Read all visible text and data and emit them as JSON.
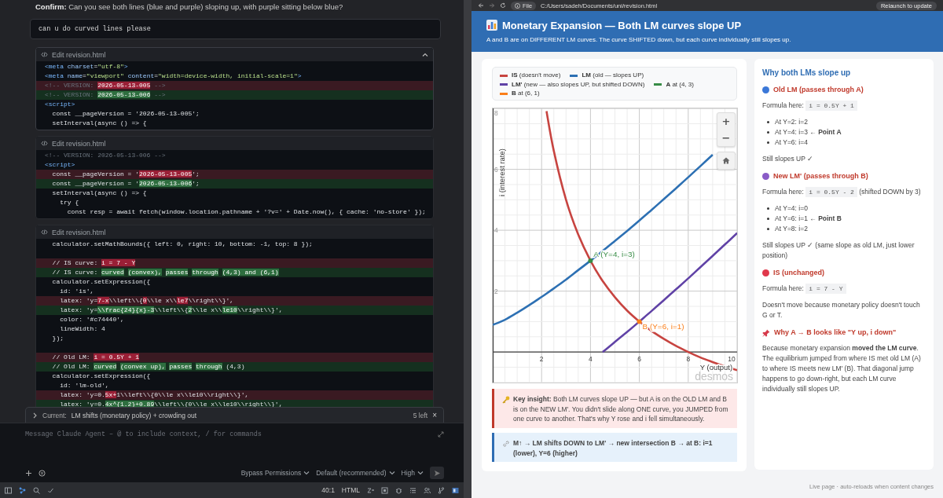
{
  "chat": {
    "confirm": "**Confirm:** Can you see both lines (blue and purple) sloping up, with purple sitting below blue?",
    "user_message": "can u do curved lines please",
    "edits": [
      {
        "title": "Edit revision.html",
        "hovered": true,
        "lines": [
          {
            "kind": "context",
            "parts": [
              {
                "text": "<meta ",
                "kind": "tag"
              },
              {
                "text": "charset",
                "kind": "attr"
              },
              {
                "text": "=",
                "kind": "plain"
              },
              {
                "text": "\"utf-8\"",
                "kind": "string"
              },
              {
                "text": ">",
                "kind": "tag"
              }
            ]
          },
          {
            "kind": "context",
            "parts": [
              {
                "text": "<meta ",
                "kind": "tag"
              },
              {
                "text": "name",
                "kind": "attr"
              },
              {
                "text": "=",
                "kind": "plain"
              },
              {
                "text": "\"viewport\"",
                "kind": "string"
              },
              {
                "text": " content",
                "kind": "attr"
              },
              {
                "text": "=",
                "kind": "plain"
              },
              {
                "text": "\"width=device-width, initial-scale=1\"",
                "kind": "string"
              },
              {
                "text": ">",
                "kind": "tag"
              }
            ]
          },
          {
            "kind": "removed",
            "parts": [
              {
                "text": "<!-- VERSION: ",
                "kind": "comment"
              },
              {
                "text": "2026-05-13-005",
                "kind": "hl"
              },
              {
                "text": " -->",
                "kind": "comment"
              }
            ]
          },
          {
            "kind": "added",
            "parts": [
              {
                "text": "<!-- VERSION: ",
                "kind": "comment"
              },
              {
                "text": "2026-05-13-006",
                "kind": "hl"
              },
              {
                "text": " -->",
                "kind": "comment"
              }
            ]
          },
          {
            "kind": "context",
            "parts": [
              {
                "text": "<script>",
                "kind": "tag"
              }
            ]
          },
          {
            "kind": "context",
            "parts": [
              {
                "text": "  const __pageVersion = '2026-05-13-005';",
                "kind": "plain"
              }
            ]
          },
          {
            "kind": "context",
            "parts": [
              {
                "text": "  setInterval(async () => {",
                "kind": "plain"
              }
            ]
          }
        ]
      },
      {
        "title": "Edit revision.html",
        "hovered": false,
        "lines": [
          {
            "kind": "context",
            "parts": [
              {
                "text": "<!-- VERSION: 2026-05-13-006 -->",
                "kind": "comment"
              }
            ]
          },
          {
            "kind": "context",
            "parts": [
              {
                "text": "<script>",
                "kind": "tag"
              }
            ]
          },
          {
            "kind": "removed",
            "parts": [
              {
                "text": "  const __pageVersion = '",
                "kind": "plain"
              },
              {
                "text": "2026-05-13-005",
                "kind": "hl"
              },
              {
                "text": "';",
                "kind": "plain"
              }
            ]
          },
          {
            "kind": "added",
            "parts": [
              {
                "text": "  const __pageVersion = '",
                "kind": "plain"
              },
              {
                "text": "2026-05-13-006",
                "kind": "hl"
              },
              {
                "text": "';",
                "kind": "plain"
              }
            ]
          },
          {
            "kind": "context",
            "parts": [
              {
                "text": "  setInterval(async () => {",
                "kind": "plain"
              }
            ]
          },
          {
            "kind": "context",
            "parts": [
              {
                "text": "    try {",
                "kind": "plain"
              }
            ]
          },
          {
            "kind": "context",
            "parts": [
              {
                "text": "      const resp = await fetch(window.location.pathname + '?v=' + Date.now(), { cache: 'no-store' });",
                "kind": "plain"
              }
            ]
          }
        ]
      },
      {
        "title": "Edit revision.html",
        "hovered": false,
        "lines": [
          {
            "kind": "context",
            "parts": [
              {
                "text": "  calculator.setMathBounds({ left: 0, right: 10, bottom: -1, top: 8 });",
                "kind": "plain"
              }
            ]
          },
          {
            "kind": "blank"
          },
          {
            "kind": "removed",
            "parts": [
              {
                "text": "  // IS curve: ",
                "kind": "plain"
              },
              {
                "text": "i = 7 - Y",
                "kind": "hl"
              }
            ]
          },
          {
            "kind": "added",
            "parts": [
              {
                "text": "  // IS curve: ",
                "kind": "plain"
              },
              {
                "text": "curved",
                "kind": "hl",
                "spaced": true
              },
              {
                "text": "(convex),",
                "kind": "hl",
                "spaced": true
              },
              {
                "text": "passes",
                "kind": "hl",
                "spaced": true
              },
              {
                "text": "through",
                "kind": "hl",
                "spaced": true
              },
              {
                "text": "(4,3) and (6,1)",
                "kind": "hl"
              }
            ]
          },
          {
            "kind": "context",
            "parts": [
              {
                "text": "  calculator.setExpression({",
                "kind": "plain"
              }
            ]
          },
          {
            "kind": "context",
            "parts": [
              {
                "text": "    id: 'is',",
                "kind": "plain"
              }
            ]
          },
          {
            "kind": "removed",
            "parts": [
              {
                "text": "    latex: 'y=",
                "kind": "plain"
              },
              {
                "text": "7-x",
                "kind": "hl"
              },
              {
                "text": "\\\\left\\\\{",
                "kind": "plain"
              },
              {
                "text": "0",
                "kind": "hl"
              },
              {
                "text": "\\\\le x\\\\",
                "kind": "plain"
              },
              {
                "text": "le7",
                "kind": "hl"
              },
              {
                "text": "\\\\right\\\\}',",
                "kind": "plain"
              }
            ]
          },
          {
            "kind": "added",
            "parts": [
              {
                "text": "    latex: 'y=",
                "kind": "plain"
              },
              {
                "text": "\\\\frac{24}{x}-3",
                "kind": "hl"
              },
              {
                "text": "\\\\left\\\\{",
                "kind": "plain"
              },
              {
                "text": "2",
                "kind": "hl"
              },
              {
                "text": "\\\\le x\\\\",
                "kind": "plain"
              },
              {
                "text": "le10",
                "kind": "hl"
              },
              {
                "text": "\\\\right\\\\}',",
                "kind": "plain"
              }
            ]
          },
          {
            "kind": "context",
            "parts": [
              {
                "text": "    color: '#c74440',",
                "kind": "plain"
              }
            ]
          },
          {
            "kind": "context",
            "parts": [
              {
                "text": "    lineWidth: 4",
                "kind": "plain"
              }
            ]
          },
          {
            "kind": "context",
            "parts": [
              {
                "text": "  });",
                "kind": "plain"
              }
            ]
          },
          {
            "kind": "blank"
          },
          {
            "kind": "removed",
            "parts": [
              {
                "text": "  // Old LM: ",
                "kind": "plain"
              },
              {
                "text": "i = 0.5Y + 1",
                "kind": "hl"
              }
            ]
          },
          {
            "kind": "added",
            "parts": [
              {
                "text": "  // Old LM: ",
                "kind": "plain"
              },
              {
                "text": "curved",
                "kind": "hl",
                "spaced": true
              },
              {
                "text": "(convex up),",
                "kind": "hl",
                "spaced": true
              },
              {
                "text": "passes",
                "kind": "hl",
                "spaced": true
              },
              {
                "text": "through",
                "kind": "hl"
              },
              {
                "text": " (4,3)",
                "kind": "plain"
              }
            ]
          },
          {
            "kind": "context",
            "parts": [
              {
                "text": "  calculator.setExpression({",
                "kind": "plain"
              }
            ]
          },
          {
            "kind": "context",
            "parts": [
              {
                "text": "    id: 'lm-old',",
                "kind": "plain"
              }
            ]
          },
          {
            "kind": "removed",
            "parts": [
              {
                "text": "    latex: 'y=0.",
                "kind": "plain"
              },
              {
                "text": "5x+",
                "kind": "hl"
              },
              {
                "text": "1\\\\left\\\\{0\\\\le x\\\\le10\\\\right\\\\}',",
                "kind": "plain"
              }
            ]
          },
          {
            "kind": "added",
            "parts": [
              {
                "text": "    latex: 'y=0.",
                "kind": "plain"
              },
              {
                "text": "4x^{1.2}+0.89",
                "kind": "hl"
              },
              {
                "text": "\\\\left\\\\{0\\\\le x\\\\le10\\\\right\\\\}',",
                "kind": "plain"
              }
            ]
          }
        ]
      }
    ],
    "queue": {
      "label": "Current:",
      "text": "LM shifts (monetary policy) + crowding out",
      "count": "5 left",
      "close": "×"
    },
    "composer": {
      "placeholder": "Message Claude Agent – @ to include context, / for commands",
      "options": [
        "Bypass Permissions",
        "Default (recommended)",
        "High"
      ]
    },
    "status": {
      "position": "40:1",
      "language": "HTML"
    }
  },
  "browser": {
    "scheme": "File",
    "url": "C:/Users/sadeh/Documents/uni/revision.html",
    "update": "Relaunch to update"
  },
  "page": {
    "title": "Monetary Expansion — Both LM curves slope UP",
    "subtitle": "A and B are on DIFFERENT LM curves. The curve SHIFTED down, but each curve individually still slopes up.",
    "graph": {
      "legend": [
        {
          "text": "**IS** (doesn't move)",
          "color": "#c74440"
        },
        {
          "text": "**LM** (old — slopes UP)",
          "color": "#2d70b3"
        },
        {
          "text": "**LM'** (new — also slopes UP, but shifted DOWN)",
          "color": "#6042a6"
        },
        {
          "text": "**A** at (4, 3)",
          "color": "#388c46"
        },
        {
          "text": "**B** at (6, 1)",
          "color": "#fa7e19"
        }
      ],
      "controls": [
        {
          "kind": "zoom_in",
          "label": "+"
        },
        {
          "kind": "zoom_out",
          "label": "−"
        },
        {
          "kind": "home"
        }
      ],
      "brand": "desmos",
      "chart_data": {
        "type": "line",
        "xlabel": "Y (output)",
        "ylabel": "i (interest rate)",
        "grid": true,
        "x": [
          0,
          0.5,
          1,
          1.5,
          2,
          2.2,
          2.5,
          3,
          3.5,
          4,
          4.5,
          5,
          5.5,
          6,
          6.5,
          7,
          7.5,
          8,
          8.5,
          9,
          9.5,
          10
        ],
        "series": [
          {
            "color": "#c74440",
            "values": [
              null,
              null,
              null,
              null,
              null,
              7.91,
              6.6,
              5,
              3.86,
              3,
              2.33,
              1.8,
              1.36,
              1,
              0.69,
              0.43,
              0.2,
              0,
              -0.18,
              -0.33,
              -0.47,
              -0.6
            ]
          },
          {
            "color": "#2d70b3",
            "values": [
              0.89,
              1.06,
              1.29,
              1.54,
              1.81,
              1.92,
              2.09,
              2.38,
              2.69,
              3,
              3.32,
              3.65,
              3.98,
              4.32,
              4.67,
              5.02,
              5.38,
              5.74,
              6.11,
              6.48,
              null,
              null
            ]
          },
          {
            "color": "#6042a6",
            "values": [
              null,
              null,
              null,
              null,
              null,
              null,
              null,
              null,
              null,
              null,
              0,
              0.33,
              0.66,
              1,
              1.35,
              1.7,
              2.06,
              2.42,
              2.79,
              3.16,
              3.53,
              3.91
            ]
          }
        ],
        "xlim": [
          0,
          10
        ],
        "ylim": [
          -1,
          8
        ],
        "xticks": [
          2,
          4,
          6,
          8,
          10
        ],
        "yticks": [
          2,
          4,
          6,
          8
        ],
        "annotations": [
          {
            "x": 4,
            "y": 3,
            "text": "A (Y=4, i=3)"
          },
          {
            "x": 6,
            "y": 1,
            "text": "B (Y=6, i=1)"
          }
        ]
      }
    },
    "callouts": [
      {
        "kind": "insight",
        "text": "**Key insight:** Both LM curves slope UP — but A is on the OLD LM and B is on the NEW LM'. You didn't slide along ONE curve, you JUMPED from one curve to another. That's why Y rose and i fell simultaneously."
      },
      {
        "kind": "summary",
        "text": "M↑ → LM shifts DOWN to LM' → new intersection B → at B: i=1 (lower), Y=6 (higher)"
      }
    ],
    "notes": {
      "heading": "Why both LMs slope up",
      "sections": [
        {
          "kind": "dot",
          "color": "#3b78d8",
          "title": "Old LM (passes through A)",
          "formula_label": "Formula here:",
          "formula": "i = 0.5Y + 1",
          "bullets": [
            "At Y=2: i=2",
            "At Y=4: i=3 ← **Point A**",
            "At Y=6: i=4"
          ],
          "note": "Still slopes UP ✓"
        },
        {
          "kind": "dot",
          "color": "#8a5cc7",
          "title": "New LM' (passes through B)",
          "formula_label": "Formula here:",
          "formula": "i = 0.5Y - 2",
          "formula_note": "(shifted DOWN by 3)",
          "bullets": [
            "At Y=4: i=0",
            "At Y=6: i=1 ← **Point B**",
            "At Y=8: i=2"
          ],
          "note": "Still slopes UP ✓ (same slope as old LM, just lower position)"
        },
        {
          "kind": "dot",
          "color": "#e0384b",
          "title": "IS (unchanged)",
          "formula_label": "Formula here:",
          "formula": "i = 7 - Y",
          "note": "Doesn't move because monetary policy doesn't touch G or T."
        },
        {
          "kind": "pin",
          "title": "Why A → B looks like \"Y up, i down\"",
          "note": "Because monetary expansion **moved the LM curve**. The equilibrium jumped from where IS met old LM (A) to where IS meets new LM' (B). That diagonal jump happens to go down-right, but each LM curve individually still slopes UP."
        }
      ]
    },
    "footer": "Live page · auto-reloads when content changes"
  }
}
